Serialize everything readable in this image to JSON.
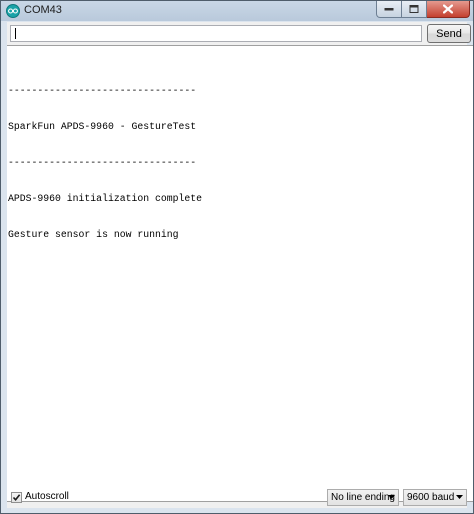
{
  "window": {
    "title": "COM43"
  },
  "toolbar": {
    "input_value": "",
    "send_label": "Send"
  },
  "console": {
    "lines": [
      "--------------------------------",
      "SparkFun APDS-9960 - GestureTest",
      "--------------------------------",
      "APDS-9960 initialization complete",
      "Gesture sensor is now running"
    ]
  },
  "footer": {
    "autoscroll_label": "Autoscroll",
    "autoscroll_checked": true,
    "line_ending_value": "No line ending",
    "baud_value": "9600 baud"
  },
  "icons": {
    "app": "arduino-icon",
    "minimize": "minimize-icon",
    "maximize": "maximize-icon",
    "close": "close-icon",
    "dropdown": "chevron-down-icon",
    "check": "checkmark-icon"
  }
}
